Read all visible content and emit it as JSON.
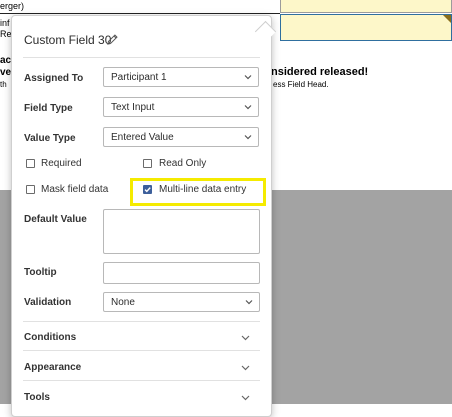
{
  "background": {
    "line1": "erger)",
    "line2": "inf",
    "line3": "Rel",
    "line4": "ac",
    "line5": "ve",
    "line6": "th",
    "released_text": "nsidered released!",
    "field_head_text": "ess Field Head."
  },
  "panel": {
    "title": "Custom Field 30",
    "assigned_to": {
      "label": "Assigned To",
      "value": "Participant 1"
    },
    "field_type": {
      "label": "Field Type",
      "value": "Text Input"
    },
    "value_type": {
      "label": "Value Type",
      "value": "Entered Value"
    },
    "checkboxes": {
      "required": {
        "label": "Required",
        "checked": false
      },
      "read_only": {
        "label": "Read Only",
        "checked": false
      },
      "mask": {
        "label": "Mask field data",
        "checked": false
      },
      "multiline": {
        "label": "Multi-line data entry",
        "checked": true
      }
    },
    "default_value": {
      "label": "Default Value",
      "value": ""
    },
    "tooltip": {
      "label": "Tooltip",
      "value": ""
    },
    "validation": {
      "label": "Validation",
      "value": "None"
    },
    "sections": {
      "conditions": "Conditions",
      "appearance": "Appearance",
      "tools": "Tools"
    }
  },
  "colors": {
    "highlight": "#f5eb00",
    "checkbox_checked": "#3d5f9b",
    "field_fill": "#fdf7c9",
    "overlay": "#a3a3a3"
  }
}
